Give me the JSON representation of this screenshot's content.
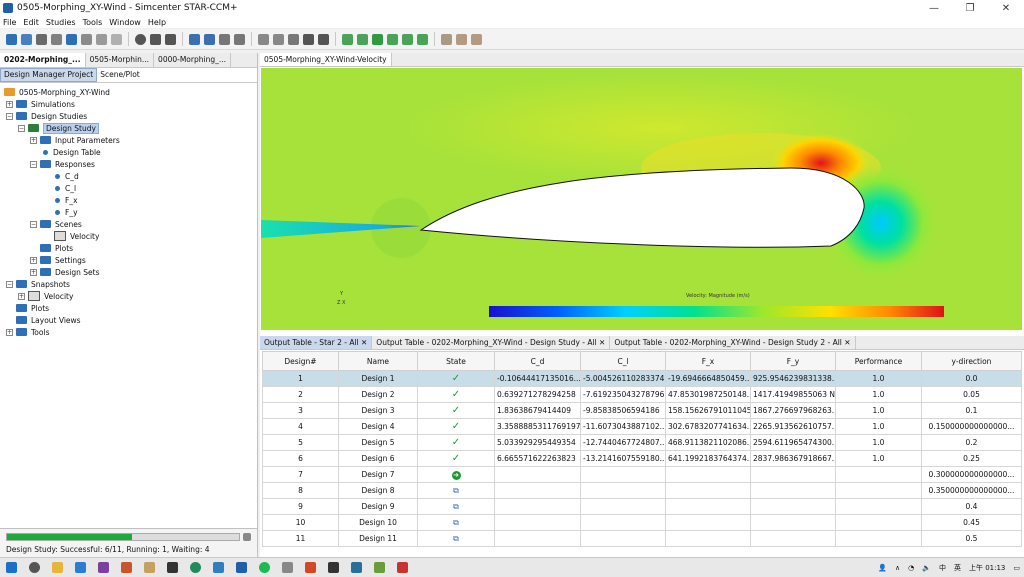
{
  "window": {
    "title": "0505-Morphing_XY-Wind - Simcenter STAR-CCM+",
    "minimize": "—",
    "restore": "❐",
    "close": "✕"
  },
  "menu": [
    "File",
    "Edit",
    "Studies",
    "Tools",
    "Window",
    "Help"
  ],
  "left": {
    "tabs": [
      "0202-Morphing_...",
      "0505-Morphin...",
      "0000-Morphing_..."
    ],
    "subtabs": [
      "Design Manager Project",
      "Scene/Plot"
    ],
    "tree": [
      {
        "label": "0505-Morphing_XY-Wind",
        "type": "root"
      },
      {
        "label": "Simulations",
        "type": "folder"
      },
      {
        "label": "Design Studies",
        "type": "folder"
      },
      {
        "label": "Design Study",
        "type": "study"
      },
      {
        "label": "Input Parameters",
        "type": "folder"
      },
      {
        "label": "Design Table",
        "type": "item"
      },
      {
        "label": "Responses",
        "type": "folder"
      },
      {
        "label": "C_d",
        "type": "item"
      },
      {
        "label": "C_l",
        "type": "item"
      },
      {
        "label": "F_x",
        "type": "item"
      },
      {
        "label": "F_y",
        "type": "item"
      },
      {
        "label": "Scenes",
        "type": "folder"
      },
      {
        "label": "Velocity",
        "type": "scene"
      },
      {
        "label": "Plots",
        "type": "folder"
      },
      {
        "label": "Settings",
        "type": "folder"
      },
      {
        "label": "Design Sets",
        "type": "folder"
      },
      {
        "label": "Snapshots",
        "type": "folder"
      },
      {
        "label": "Velocity",
        "type": "scene"
      },
      {
        "label": "Plots",
        "type": "folder"
      },
      {
        "label": "Layout Views",
        "type": "folder"
      },
      {
        "label": "Tools",
        "type": "folder"
      }
    ],
    "status": "Design Study: Successful: 6/11, Running: 1, Waiting: 4",
    "progress_fraction": 0.54
  },
  "scene": {
    "tab": "0505-Morphing_XY-Wind-Velocity",
    "colorbar_label": "Velocity: Magnitude (m/s)",
    "axis_y": "Y",
    "axis_x": "Z X"
  },
  "output": {
    "tabs": [
      "Output Table - Star 2 - All",
      "Output Table - 0202-Morphing_XY-Wind - Design Study - All",
      "Output Table - 0202-Morphing_XY-Wind - Design Study 2 - All"
    ],
    "columns": [
      "Design#",
      "Name",
      "State",
      "C_d",
      "C_l",
      "F_x",
      "F_y",
      "Performance",
      "y-direction"
    ],
    "rows": [
      {
        "n": "1",
        "name": "Design 1",
        "state": "done",
        "cd": "-0.10644417135016...",
        "cl": "-5.004526110283374",
        "fx": "-19.6946664850459...",
        "fy": "925.9546239831338...",
        "perf": "1.0",
        "yd": "0.0"
      },
      {
        "n": "2",
        "name": "Design 2",
        "state": "done",
        "cd": "0.639271278294258",
        "cl": "-7.619235043278796",
        "fx": "47.85301987250148...",
        "fy": "1417.41949855063 N",
        "perf": "1.0",
        "yd": "0.05"
      },
      {
        "n": "3",
        "name": "Design 3",
        "state": "done",
        "cd": "1.83638679414409",
        "cl": "-9.85838506594186",
        "fx": "158.15626791011045...",
        "fy": "1867.276697968263...",
        "perf": "1.0",
        "yd": "0.1"
      },
      {
        "n": "4",
        "name": "Design 4",
        "state": "done",
        "cd": "3.3588885311769197",
        "cl": "-11.6073043887102...",
        "fx": "302.6783207741634...",
        "fy": "2265.913562610757...",
        "perf": "1.0",
        "yd": "0.150000000000000..."
      },
      {
        "n": "5",
        "name": "Design 5",
        "state": "done",
        "cd": "5.033929295449354",
        "cl": "-12.7440467724807...",
        "fx": "468.9113821102086...",
        "fy": "2594.611965474300...",
        "perf": "1.0",
        "yd": "0.2"
      },
      {
        "n": "6",
        "name": "Design 6",
        "state": "done",
        "cd": "6.665571622263823",
        "cl": "-13.2141607559180...",
        "fx": "641.1992183764374...",
        "fy": "2837.986367918667...",
        "perf": "1.0",
        "yd": "0.25"
      },
      {
        "n": "7",
        "name": "Design 7",
        "state": "running",
        "cd": "",
        "cl": "",
        "fx": "",
        "fy": "",
        "perf": "",
        "yd": "0.300000000000000..."
      },
      {
        "n": "8",
        "name": "Design 8",
        "state": "waiting",
        "cd": "",
        "cl": "",
        "fx": "",
        "fy": "",
        "perf": "",
        "yd": "0.350000000000000..."
      },
      {
        "n": "9",
        "name": "Design 9",
        "state": "waiting",
        "cd": "",
        "cl": "",
        "fx": "",
        "fy": "",
        "perf": "",
        "yd": "0.4"
      },
      {
        "n": "10",
        "name": "Design 10",
        "state": "waiting",
        "cd": "",
        "cl": "",
        "fx": "",
        "fy": "",
        "perf": "",
        "yd": "0.45"
      },
      {
        "n": "11",
        "name": "Design 11",
        "state": "waiting",
        "cd": "",
        "cl": "",
        "fx": "",
        "fy": "",
        "perf": "",
        "yd": "0.5"
      }
    ]
  },
  "taskbar": {
    "ime": "中",
    "lang": "英",
    "time": "上午 01:13"
  }
}
